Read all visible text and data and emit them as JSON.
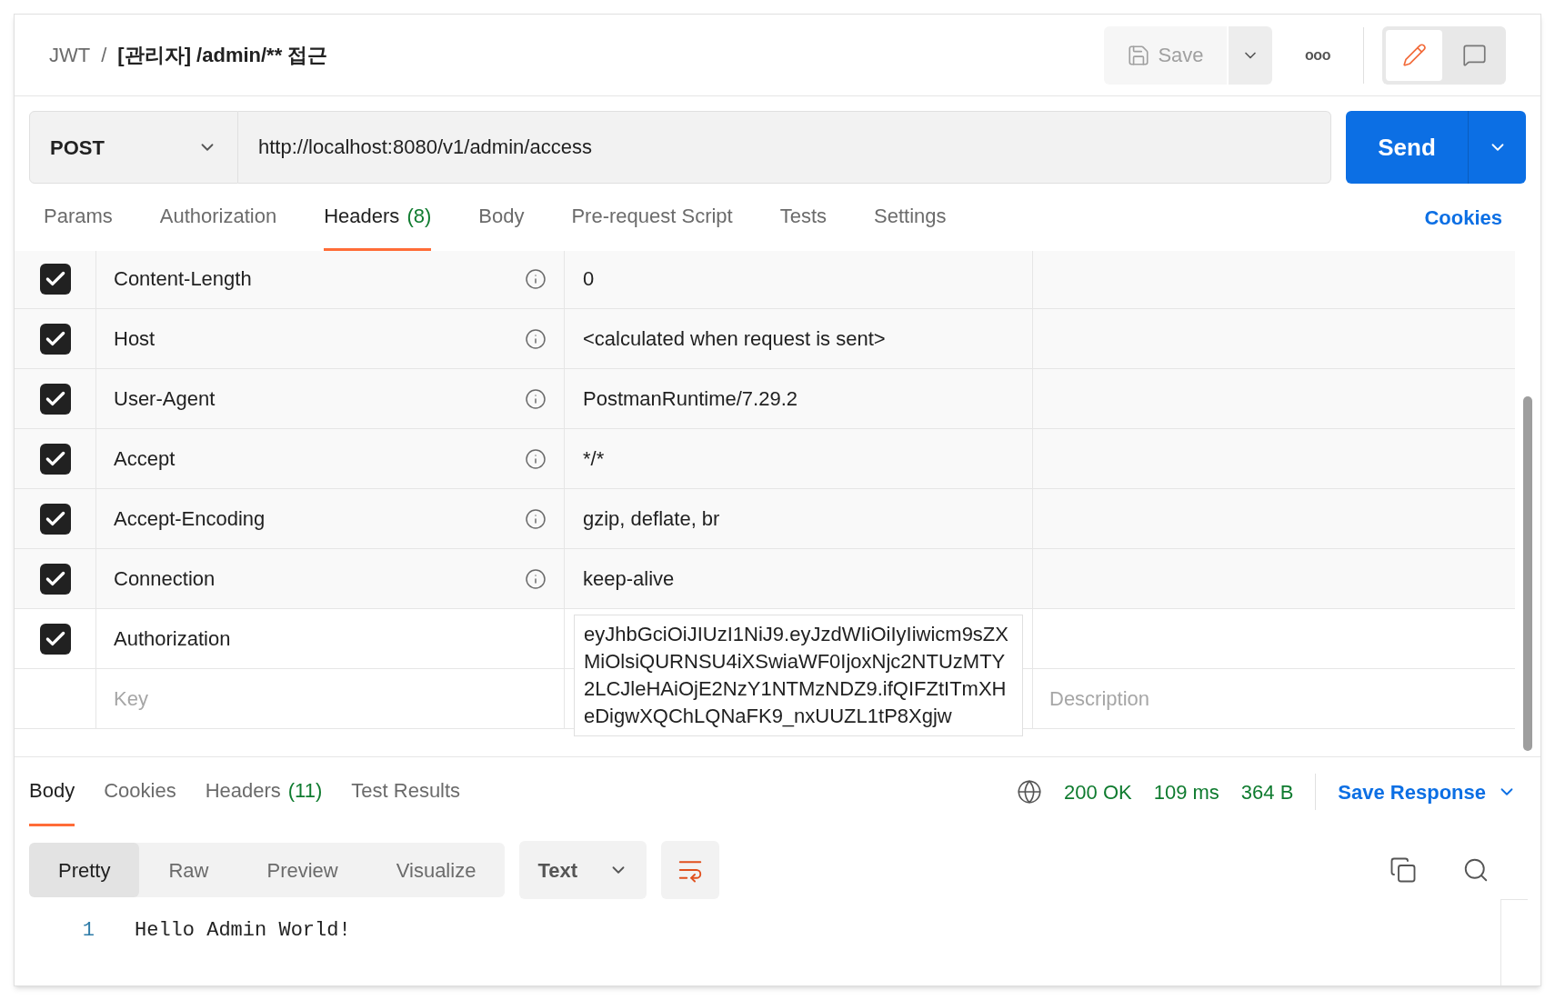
{
  "breadcrumb": {
    "collection": "JWT",
    "separator": "/",
    "request": "[관리자] /admin/** 접근"
  },
  "toolbar": {
    "save": "Save",
    "more": "ooo",
    "modes": [
      {
        "kind": "edit",
        "selected": true
      },
      {
        "kind": "comments",
        "selected": false
      }
    ]
  },
  "request": {
    "method": "POST",
    "url": "http://localhost:8080/v1/admin/access",
    "send": "Send"
  },
  "tabs": [
    {
      "label": "Params",
      "selected": false
    },
    {
      "label": "Authorization",
      "selected": false
    },
    {
      "label": "Headers",
      "count": "(8)",
      "selected": true
    },
    {
      "label": "Body",
      "selected": false
    },
    {
      "label": "Pre-request Script",
      "selected": false
    },
    {
      "label": "Tests",
      "selected": false
    },
    {
      "label": "Settings",
      "selected": false
    }
  ],
  "cookies_link": "Cookies",
  "headers": [
    {
      "checked": true,
      "key": "Content-Length",
      "info": true,
      "value": "0"
    },
    {
      "checked": true,
      "key": "Host",
      "info": true,
      "value": "<calculated when request is sent>"
    },
    {
      "checked": true,
      "key": "User-Agent",
      "info": true,
      "value": "PostmanRuntime/7.29.2"
    },
    {
      "checked": true,
      "key": "Accept",
      "info": true,
      "value": "*/*"
    },
    {
      "checked": true,
      "key": "Accept-Encoding",
      "info": true,
      "value": "gzip, deflate, br"
    },
    {
      "checked": true,
      "key": "Connection",
      "info": true,
      "value": "keep-alive"
    },
    {
      "checked": true,
      "key": "Authorization",
      "info": false,
      "value": "eyJhbGciOiJIUzI1NiJ9.eyJzdWIiOiIyIiwicm9sZXMiOlsiQURNSU4iXSwiaWF0IjoxNjc2NTUzMTY2LCJleHAiOjE2NzY1NTMzNDZ9.ifQIFZtITmXHeDigwXQChLQNaFK9_nxUUZL1tP8Xgjw",
      "expanded": true
    }
  ],
  "new_header": {
    "key_placeholder": "Key",
    "description_placeholder": "Description"
  },
  "response": {
    "tabs": [
      {
        "label": "Body",
        "selected": true
      },
      {
        "label": "Cookies",
        "selected": false
      },
      {
        "label": "Headers",
        "count": "(11)",
        "selected": false
      },
      {
        "label": "Test Results",
        "selected": false
      }
    ],
    "status": "200 OK",
    "time": "109 ms",
    "size": "364 B",
    "save_response": "Save Response",
    "views": [
      {
        "label": "Pretty",
        "selected": true
      },
      {
        "label": "Raw",
        "selected": false
      },
      {
        "label": "Preview",
        "selected": false
      },
      {
        "label": "Visualize",
        "selected": false
      }
    ],
    "format": "Text",
    "wrap_lines": true,
    "lines": [
      {
        "number": "1",
        "text": "Hello Admin World!"
      }
    ]
  }
}
